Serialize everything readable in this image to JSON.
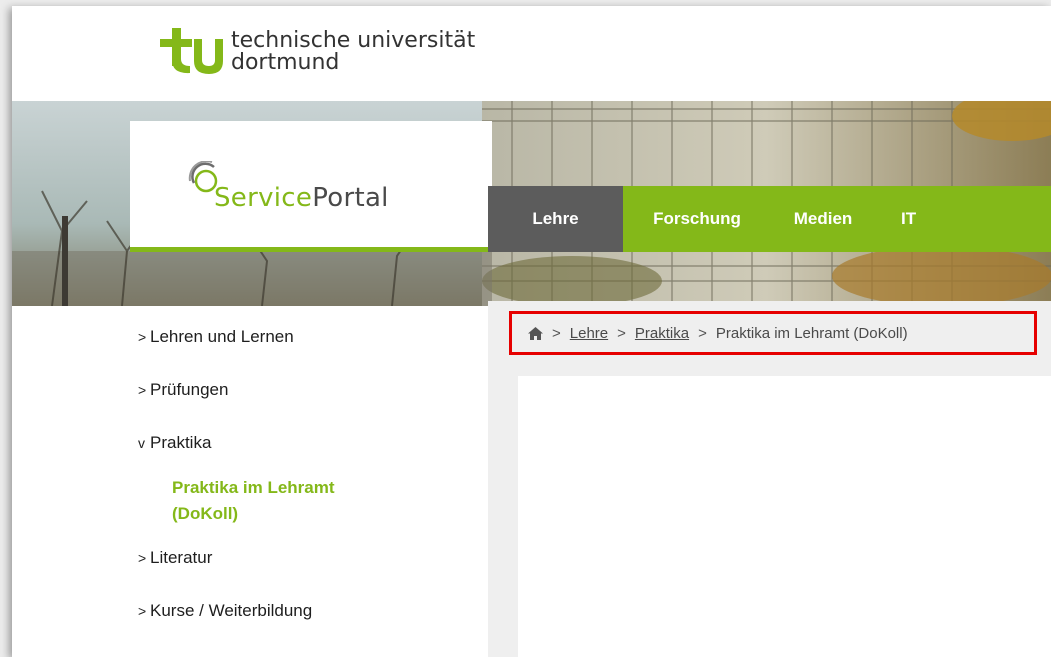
{
  "header": {
    "logo_line1": "technische universität",
    "logo_line2": "dortmund"
  },
  "service_portal": {
    "brand_part1": "Service",
    "brand_part2": "Portal"
  },
  "main_nav": {
    "items": [
      {
        "label": "Lehre",
        "active": true
      },
      {
        "label": "Forschung",
        "active": false
      },
      {
        "label": "Medien",
        "active": false
      },
      {
        "label": "IT",
        "active": false
      }
    ]
  },
  "sidebar": {
    "items": [
      {
        "label": "Lehren und Lernen",
        "chevron": ">"
      },
      {
        "label": "Prüfungen",
        "chevron": ">"
      },
      {
        "label": "Praktika",
        "chevron": "v"
      },
      {
        "label": "Literatur",
        "chevron": ">"
      },
      {
        "label": "Kurse / Weiterbildung",
        "chevron": ">"
      }
    ],
    "active_sub_line1": "Praktika im Lehramt",
    "active_sub_line2": "(DoKoll)"
  },
  "breadcrumb": {
    "home_icon": "home-icon",
    "separator": ">",
    "crumbs": [
      "Lehre",
      "Praktika"
    ],
    "current": "Praktika im Lehramt (DoKoll)"
  },
  "colors": {
    "accent_green": "#84b819",
    "nav_active": "#5c5c5c",
    "highlight_border": "#e60000"
  }
}
